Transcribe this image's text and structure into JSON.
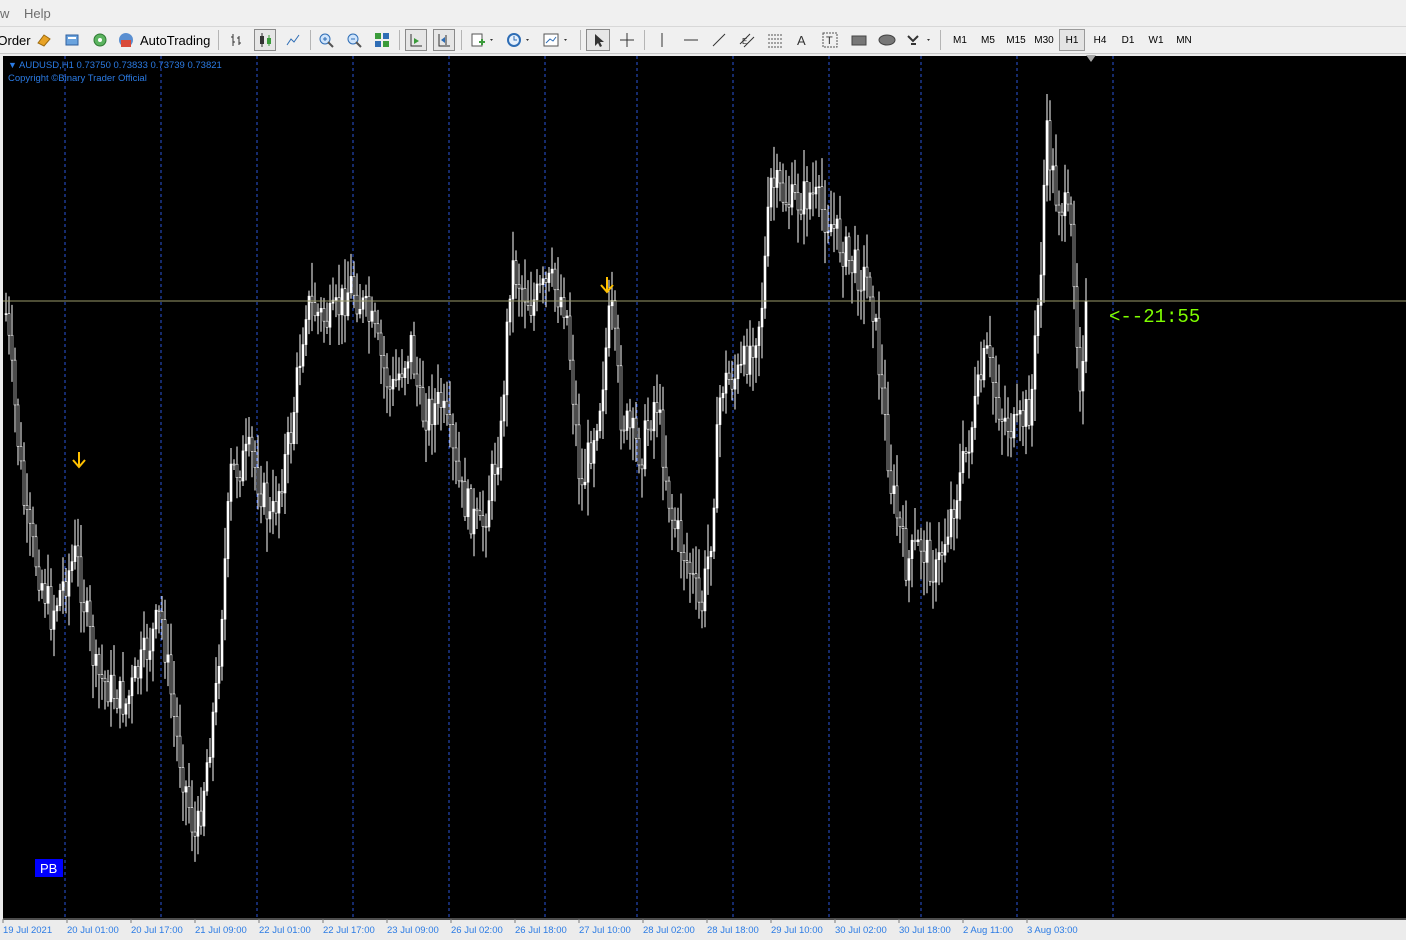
{
  "menu": {
    "partial": "w",
    "help": "Help"
  },
  "toolbar": {
    "order_label": "Order",
    "autotrading_label": "AutoTrading",
    "timeframes": [
      "M1",
      "M5",
      "M15",
      "M30",
      "H1",
      "H4",
      "D1",
      "W1",
      "MN"
    ],
    "active_timeframe": "H1"
  },
  "chart": {
    "header": "AUDUSD,H1  0.73750 0.73833 0.73739 0.73821",
    "copyright": "Copyright ©Binary Trader Official",
    "countdown": "<--21:55",
    "badge": "PB",
    "time_labels": [
      "19 Jul 2021",
      "20 Jul 01:00",
      "20 Jul 17:00",
      "21 Jul 09:00",
      "22 Jul 01:00",
      "22 Jul 17:00",
      "23 Jul 09:00",
      "26 Jul 02:00",
      "26 Jul 18:00",
      "27 Jul 10:00",
      "28 Jul 02:00",
      "28 Jul 18:00",
      "29 Jul 10:00",
      "30 Jul 02:00",
      "30 Jul 18:00",
      "2 Aug 11:00",
      "3 Aug 03:00"
    ],
    "colors": {
      "background": "#000000",
      "candles": "#ffffff",
      "grid": "#2a53d8",
      "text": "#2b7be4",
      "countdown": "#7fff00",
      "arrow": "#ffc000",
      "badge": "#0000ff"
    }
  }
}
